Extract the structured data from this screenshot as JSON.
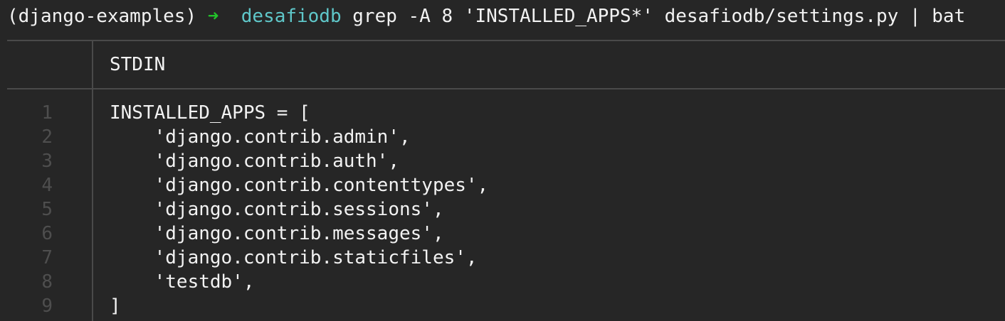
{
  "prompt": {
    "env": "(django-examples)",
    "arrow": "➜",
    "directory": "desafiodb",
    "command": "grep -A 8 'INSTALLED_APPS*' desafiodb/settings.py | bat"
  },
  "bat": {
    "header": "STDIN",
    "lines": [
      {
        "number": "1",
        "text": "INSTALLED_APPS = ["
      },
      {
        "number": "2",
        "text": "    'django.contrib.admin',"
      },
      {
        "number": "3",
        "text": "    'django.contrib.auth',"
      },
      {
        "number": "4",
        "text": "    'django.contrib.contenttypes',"
      },
      {
        "number": "5",
        "text": "    'django.contrib.sessions',"
      },
      {
        "number": "6",
        "text": "    'django.contrib.messages',"
      },
      {
        "number": "7",
        "text": "    'django.contrib.staticfiles',"
      },
      {
        "number": "8",
        "text": "    'testdb',"
      },
      {
        "number": "9",
        "text": "]"
      }
    ]
  },
  "colors": {
    "background": "#262626",
    "arrow": "#22c22a",
    "directory": "#5fc7c9",
    "line_number": "#4e4e4e",
    "border": "#4a4a4a"
  }
}
